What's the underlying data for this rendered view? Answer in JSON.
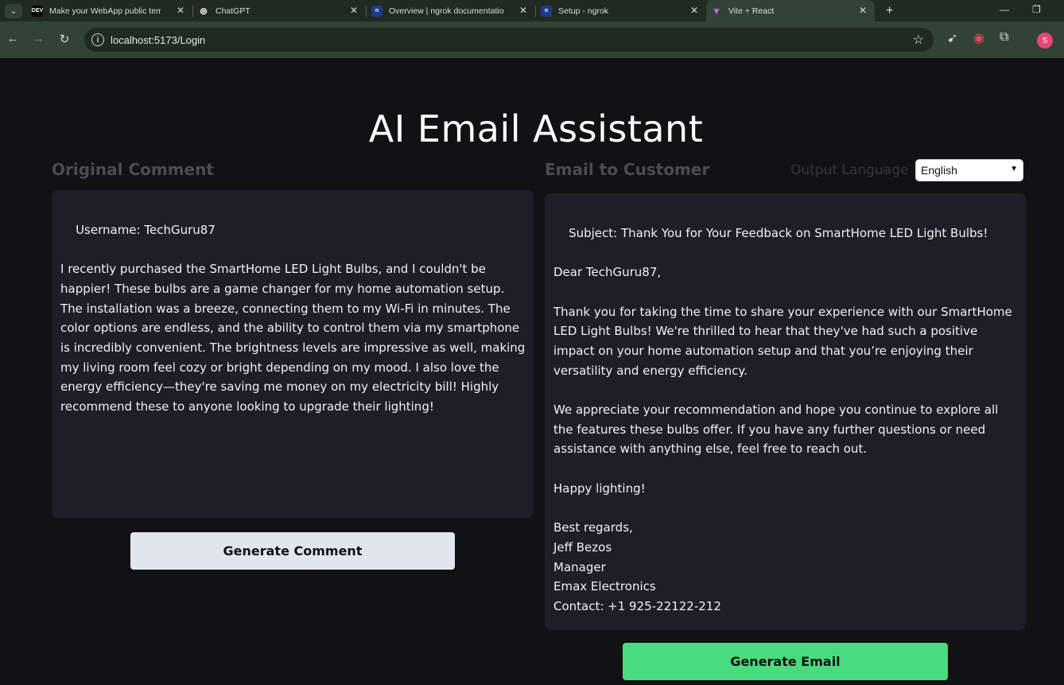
{
  "browser": {
    "tabs": [
      {
        "title": "Make your WebApp public tem",
        "favicon": "DEV"
      },
      {
        "title": "ChatGPT",
        "favicon": "chatgpt"
      },
      {
        "title": "Overview | ngrok documentatio",
        "favicon": "ngrok"
      },
      {
        "title": "Setup - ngrok",
        "favicon": "ngrok"
      },
      {
        "title": "Vite + React",
        "favicon": "vite"
      }
    ],
    "url": "localhost:5173/Login",
    "profile_initial": "S"
  },
  "app": {
    "title": "AI Email Assistant",
    "original_comment_label": "Original Comment",
    "email_label": "Email to Customer",
    "output_language_label": "Output Language",
    "output_language_value": "English",
    "original_comment_text": "Username: TechGuru87\n\nI recently purchased the SmartHome LED Light Bulbs, and I couldn't be happier! These bulbs are a game changer for my home automation setup. The installation was a breeze, connecting them to my Wi-Fi in minutes. The color options are endless, and the ability to control them via my smartphone is incredibly convenient. The brightness levels are impressive as well, making my living room feel cozy or bright depending on my mood. I also love the energy efficiency—they're saving me money on my electricity bill! Highly recommend these to anyone looking to upgrade their lighting!",
    "email_text": "Subject: Thank You for Your Feedback on SmartHome LED Light Bulbs!\n\nDear TechGuru87,\n\nThank you for taking the time to share your experience with our SmartHome LED Light Bulbs! We're thrilled to hear that they've had such a positive impact on your home automation setup and that you’re enjoying their versatility and energy efficiency.\n\nWe appreciate your recommendation and hope you continue to explore all the features these bulbs offer. If you have any further questions or need assistance with anything else, feel free to reach out.\n\nHappy lighting!\n\nBest regards,\nJeff Bezos\nManager\nEmax Electronics\nContact: +1 925-22122-212",
    "generate_comment_label": "Generate Comment",
    "generate_email_label": "Generate Email"
  },
  "colors": {
    "generate_email_button": "#48dc7e",
    "generate_comment_button": "#e1e6ee",
    "page_background": "#121215",
    "textbox_background": "#1e1e28"
  }
}
